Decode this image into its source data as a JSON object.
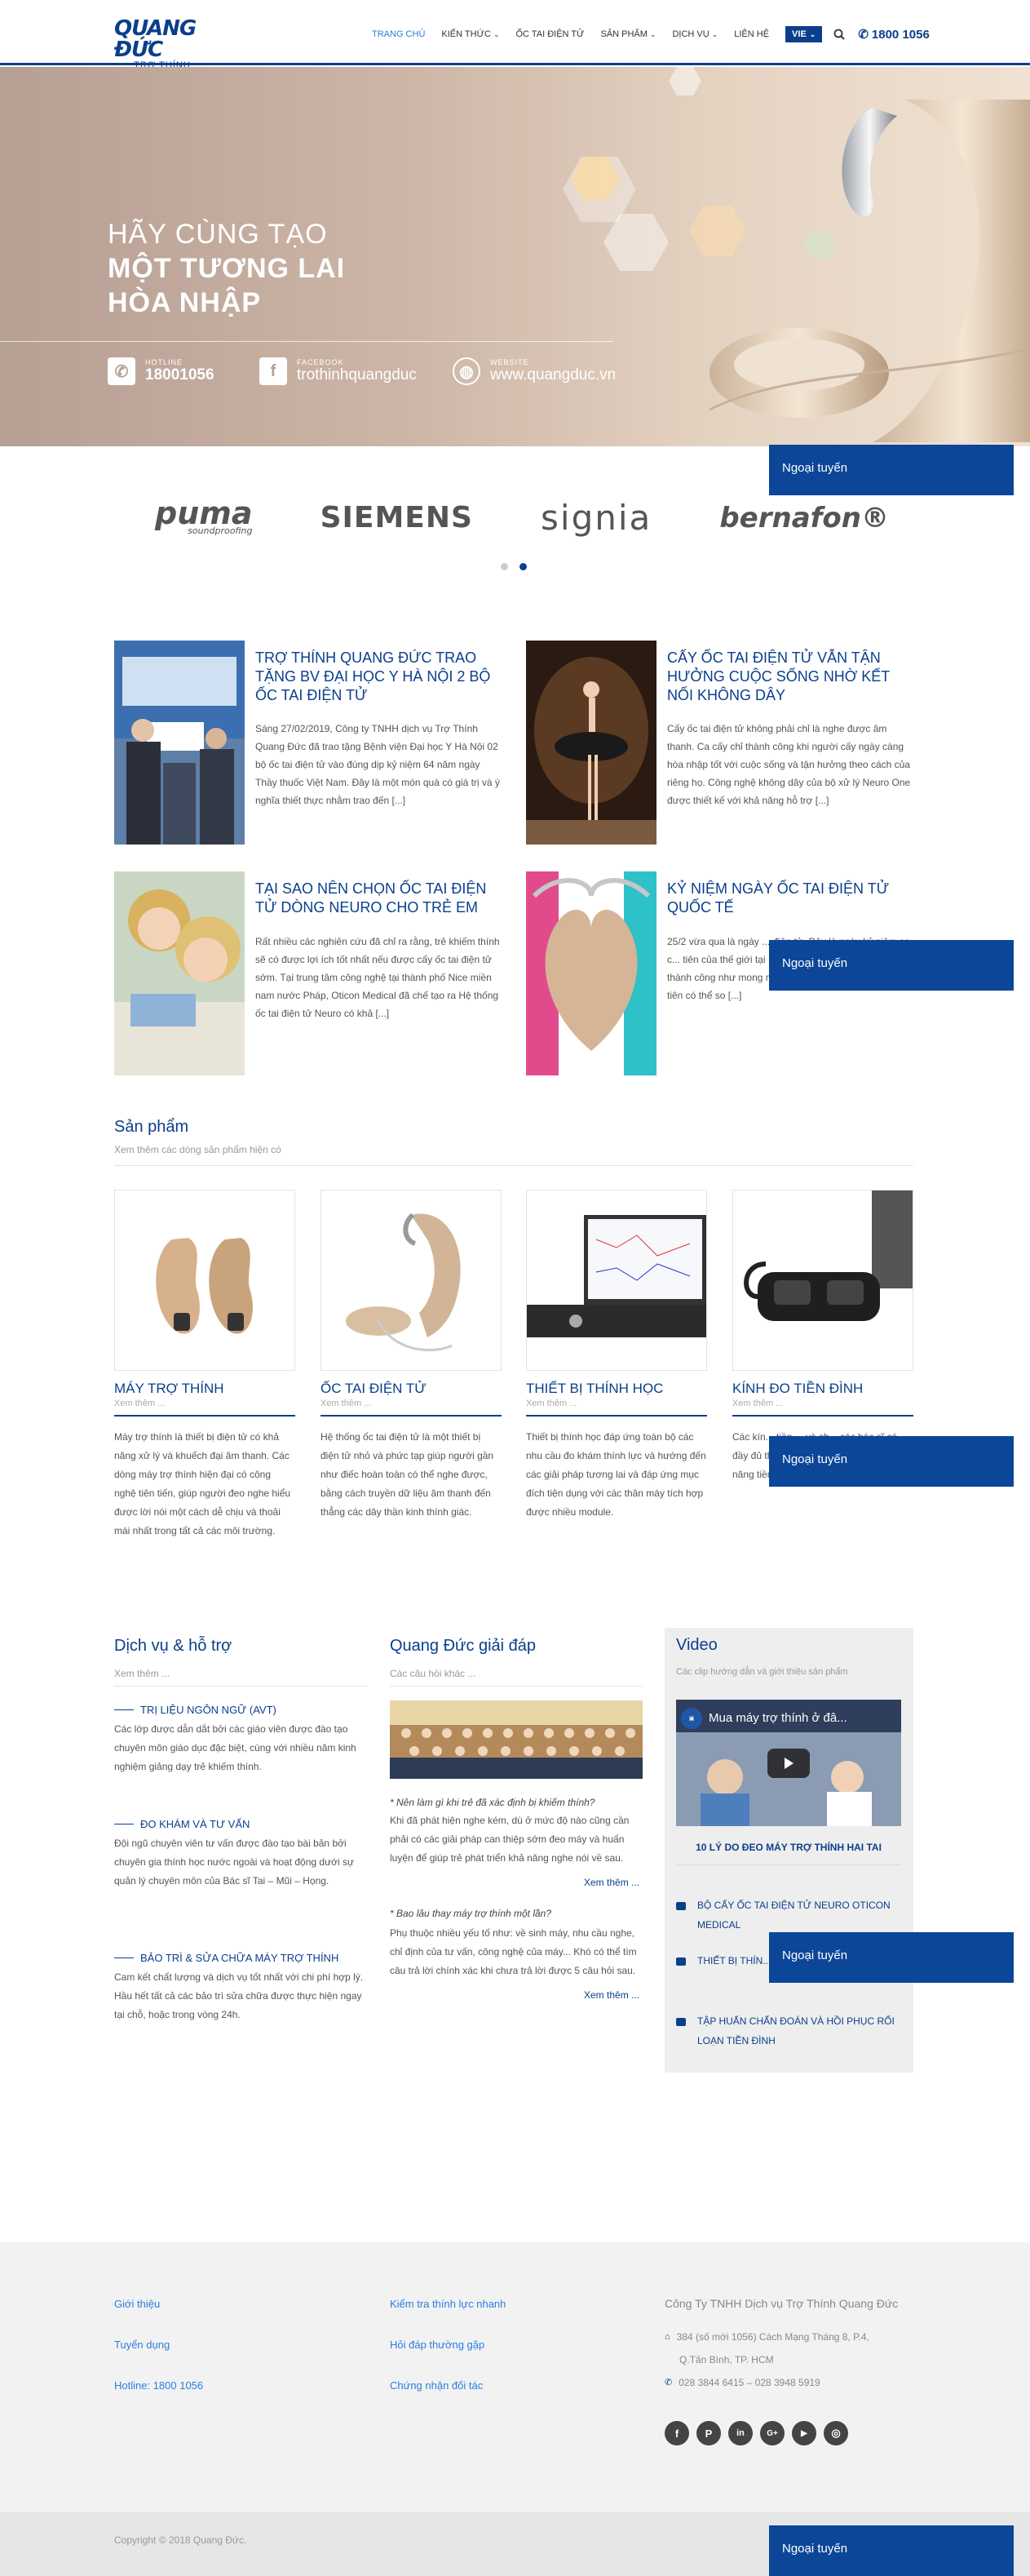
{
  "header": {
    "logo_main": "QUANG ĐỨC",
    "logo_sub": "TRỢ THÍNH",
    "nav": [
      "TRANG CHỦ",
      "KIẾN THỨC",
      "ỐC TAI ĐIỆN TỬ",
      "SẢN PHẨM",
      "DỊCH VỤ",
      "LIÊN HỆ"
    ],
    "lang": "VIE",
    "hotline": "1800 1056",
    "accent": "#0b3f8c"
  },
  "hero": {
    "subtitle": "HÃY CÙNG TẠO",
    "title_line1": "MỘT TƯƠNG LAI",
    "title_line2": "HÒA NHẬP",
    "hotline_label": "HOTLINE",
    "hotline_value": "18001056",
    "facebook_label": "FACEBOOK",
    "facebook_value": "trothinhquangduc",
    "website_label": "WEBSITE",
    "website_value": "www.quangduc.vn"
  },
  "brands": {
    "puma": "puma",
    "puma_sub": "soundproofing",
    "siemens": "SIEMENS",
    "signia": "signia",
    "bernafon": "bernafon®"
  },
  "offline_label": "Ngoại tuyến",
  "news": [
    {
      "title": "TRỢ THÍNH QUANG ĐỨC TRAO TẶNG BV ĐẠI HỌC Y HÀ NỘI 2 BỘ ỐC TAI ĐIỆN TỬ",
      "excerpt": "Sáng 27/02/2019, Công ty TNHH dịch vụ Trợ Thính Quang Đức đã trao tặng Bệnh viện Đại học Y Hà Nội 02 bộ ốc tai điện tử vào đúng dịp kỷ niệm 64 năm ngày Thầy thuốc Việt Nam. Đây là một món quà có giá trị và ý nghĩa thiết thực nhằm trao đến [...]"
    },
    {
      "title": "CẤY ỐC TAI ĐIỆN TỬ VẪN TẬN HƯỞNG CUỘC SỐNG NHỜ KẾT NỐI KHÔNG DÂY",
      "excerpt": "Cấy ốc tai điện tử không phải chỉ là nghe được âm thanh. Ca cấy chỉ thành công khi người cấy ngày càng hòa nhập tốt với cuộc sống và tận hưởng theo cách của riêng họ. Công nghệ không dây của bộ xử lý Neuro One được thiết kế với khả năng hỗ trợ [...]"
    },
    {
      "title": "TẠI SAO NÊN CHỌN ỐC TAI ĐIỆN TỬ DÒNG NEURO CHO TRẺ EM",
      "excerpt": "Rất nhiều các nghiên cứu đã chỉ ra rằng, trẻ khiếm thính sẽ có được lợi ích tốt nhất nếu được cấy ốc tai điện tử sớm. Tại trung tâm công nghệ tại thành phố Nice miền nam nước Pháp, Oticon Medical đã chế tạo ra Hệ thống ốc tai điện tử Neuro có khả [...]"
    },
    {
      "title": "KỶ NIỆM NGÀY ỐC TAI ĐIỆN TỬ QUỐC TẾ",
      "excerpt": "25/2 vừa qua là ngày ... điện tử. Đây là ngày kỷ niệm ca c... tiên của thế giới tại ... Việc cấy ghép này không đạt thành công như mong muốn, nhưng đó là bước tiến đầu tiên có thể so [...]"
    }
  ],
  "products": {
    "title": "Sản phẩm",
    "subtitle": "Xem thêm các dòng sản phẩm hiện có",
    "more": "Xem thêm ...",
    "items": [
      {
        "name": "MÁY TRỢ THÍNH",
        "desc": "Máy trợ thính là thiết bị điện tử có khả năng xử lý và khuếch đại âm thanh. Các dòng máy trợ thính hiện đại có công nghệ tiên tiến, giúp người đeo nghe hiểu được lời nói một cách dễ chịu và thoải mái nhất trong tất cả các môi trường."
      },
      {
        "name": "ỐC TAI ĐIỆN TỬ",
        "desc": "Hệ thống ốc tai điện tử là một thiết bị điện tử nhỏ và phức tạp giúp người gần như điếc hoàn toàn có thể nghe được, bằng cách truyền dữ liệu âm thanh đến thẳng các dây thần kinh thính giác."
      },
      {
        "name": "THIẾT BỊ THÍNH HỌC",
        "desc": "Thiết bị thính học đáp ứng toàn bộ các nhu cầu đo khám thính lực và hướng đến các giải pháp tương lai và đáp ứng mục đích tiện dụng với các thân máy tích hợp được nhiều module."
      },
      {
        "name": "KÍNH ĐO TIỀN ĐÌNH",
        "desc": "Các kín... tiền ... và ch... các bác sĩ có đầy đủ thông tin hơn để chẩn đoán chức năng tiền đình."
      }
    ]
  },
  "services": {
    "title": "Dịch vụ & hỗ trợ",
    "subtitle": "Xem thêm ...",
    "items": [
      {
        "head": "TRỊ LIỆU NGÔN NGỮ (AVT)",
        "text": "Các lớp được dẫn dắt bởi các giáo viên được đào tạo chuyên môn giáo dục đặc biệt, cùng với nhiều năm kinh nghiệm giảng dạy trẻ khiếm thính."
      },
      {
        "head": "ĐO KHÁM VÀ TƯ VẤN",
        "text": "Đội ngũ chuyên viên tư vấn được đào tạo bài bản bởi chuyên gia thính học nước ngoài và hoạt động dưới sự quản lý chuyên môn của Bác sĩ Tai – Mũi – Họng."
      },
      {
        "head": "BẢO TRÌ & SỬA CHỮA MÁY TRỢ THÍNH",
        "text": "Cam kết chất lượng và dịch vụ tốt nhất với chi phí hợp lý. Hầu hết tất cả các bảo trì sửa chữa được thực hiện ngay tại chỗ, hoặc trong vòng 24h."
      }
    ]
  },
  "qa": {
    "title": "Quang Đức giải đáp",
    "subtitle": "Các câu hỏi khác ...",
    "items": [
      {
        "q": "* Nên làm gì khi trẻ đã xác định bị khiếm thính?",
        "a": "Khi đã phát hiện nghe kém, dù ở mức độ nào cũng cần phải có các giải pháp can thiệp sớm đeo máy và huấn luyện để giúp trẻ phát triển khả năng nghe nói về sau.",
        "more": "Xem thêm ..."
      },
      {
        "q": "* Bao lâu thay máy trợ thính một lần?",
        "a": "Phụ thuộc nhiều yếu tố như: về sinh máy, nhu cầu nghe, chỉ định của tư vấn, công nghệ của máy... Khó có thể tìm câu trả lời chính xác khi chưa trả lời được 5 câu hỏi sau.",
        "more": "Xem thêm ..."
      }
    ]
  },
  "video": {
    "title": "Video",
    "subtitle": "Các clip hướng dẫn và giới thiệu sản phẩm",
    "player_title": "Mua máy trợ thính ở đâ...",
    "caption": "10 LÝ DO ĐEO MÁY TRỢ THÍNH HAI TAI",
    "list": [
      "BỘ CẤY ỐC TAI ĐIỆN TỬ NEURO OTICON MEDICAL",
      "THIẾT BỊ THÍN... CÔNG NGHỆ ĐỘT PHÁ",
      "TẬP HUẤN CHẨN ĐOÁN VÀ HỒI PHỤC RỐI LOẠN TIỀN ĐÌNH"
    ]
  },
  "footer": {
    "col1": [
      "Giới thiệu",
      "Tuyển dụng",
      "Hotline: 1800 1056"
    ],
    "col2": [
      "Kiểm tra thính lực nhanh",
      "Hỏi đáp thường gặp",
      "Chứng nhận đối tác"
    ],
    "company": "Công Ty TNHH Dịch vụ Trợ Thính Quang Đức",
    "address_line1": "384 (số mới 1056) Cách Mạng Tháng 8, P.4,",
    "address_line2": "Q.Tân Bình, TP. HCM",
    "phone": "028 3844 6415 – 028 3948 5919",
    "social": [
      "f",
      "P",
      "in",
      "G+",
      "▶",
      "◎"
    ],
    "copyright": "Copyright © 2018 Quang Đức."
  }
}
